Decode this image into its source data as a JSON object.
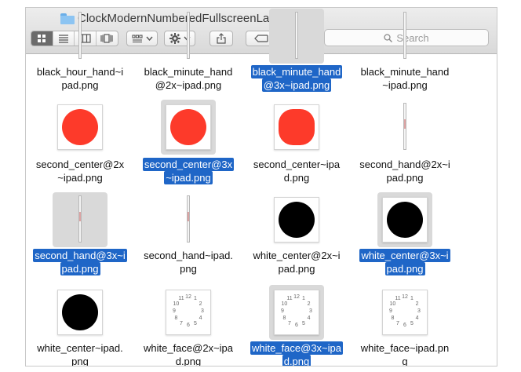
{
  "window": {
    "title": "ClockModernNumberedFullscreenLandscape"
  },
  "toolbar": {
    "view_modes": [
      {
        "icon": "icon-view-grid-icon",
        "active": true
      },
      {
        "icon": "list-view-icon",
        "active": false
      },
      {
        "icon": "column-view-icon",
        "active": false
      },
      {
        "icon": "cover-flow-icon",
        "active": false
      }
    ],
    "arrange_icon": "arrange-grid-icon",
    "action_icon": "gear-icon",
    "share_icon": "share-icon",
    "tags_icon": "tag-icon",
    "search_placeholder": "Search",
    "search_icon": "magnifier-icon"
  },
  "colors": {
    "accent": "#1f66c7",
    "red_circle": "#fd3a2a",
    "black_circle": "#000000"
  },
  "files": [
    {
      "name_lines": [
        "black_hour_hand~i",
        "pad.png"
      ],
      "kind": "hand-partial",
      "selected": false
    },
    {
      "name_lines": [
        "black_minute_hand",
        "@2x~ipad.png"
      ],
      "kind": "hand-partial",
      "selected": false
    },
    {
      "name_lines": [
        "black_minute_hand",
        "@3x~ipad.png"
      ],
      "kind": "hand-partial",
      "selected": true
    },
    {
      "name_lines": [
        "black_minute_hand",
        "~ipad.png"
      ],
      "kind": "hand-partial",
      "selected": false
    },
    {
      "name_lines": [
        "second_center@2x",
        "~ipad.png"
      ],
      "kind": "red-circle",
      "selected": false
    },
    {
      "name_lines": [
        "second_center@3x",
        "~ipad.png"
      ],
      "kind": "red-circle",
      "selected": true
    },
    {
      "name_lines": [
        "second_center~ipa",
        "d.png"
      ],
      "kind": "red-circle-pixel",
      "selected": false
    },
    {
      "name_lines": [
        "second_hand@2x~i",
        "pad.png"
      ],
      "kind": "hand",
      "selected": false
    },
    {
      "name_lines": [
        "second_hand@3x~i",
        "pad.png"
      ],
      "kind": "hand",
      "selected": true
    },
    {
      "name_lines": [
        "second_hand~ipad.",
        "png"
      ],
      "kind": "hand",
      "selected": false
    },
    {
      "name_lines": [
        "white_center@2x~i",
        "pad.png"
      ],
      "kind": "black-circle",
      "selected": false
    },
    {
      "name_lines": [
        "white_center@3x~i",
        "pad.png"
      ],
      "kind": "black-circle",
      "selected": true
    },
    {
      "name_lines": [
        "white_center~ipad.",
        "png"
      ],
      "kind": "black-circle",
      "selected": false
    },
    {
      "name_lines": [
        "white_face@2x~ipa",
        "d.png"
      ],
      "kind": "clock-face",
      "selected": false
    },
    {
      "name_lines": [
        "white_face@3x~ipa",
        "d.png"
      ],
      "kind": "clock-face",
      "selected": true
    },
    {
      "name_lines": [
        "white_face~ipad.pn",
        "g"
      ],
      "kind": "clock-face",
      "selected": false
    }
  ],
  "clock_numbers": [
    "12",
    "1",
    "2",
    "3",
    "4",
    "5",
    "6",
    "7",
    "8",
    "9",
    "10",
    "11"
  ]
}
